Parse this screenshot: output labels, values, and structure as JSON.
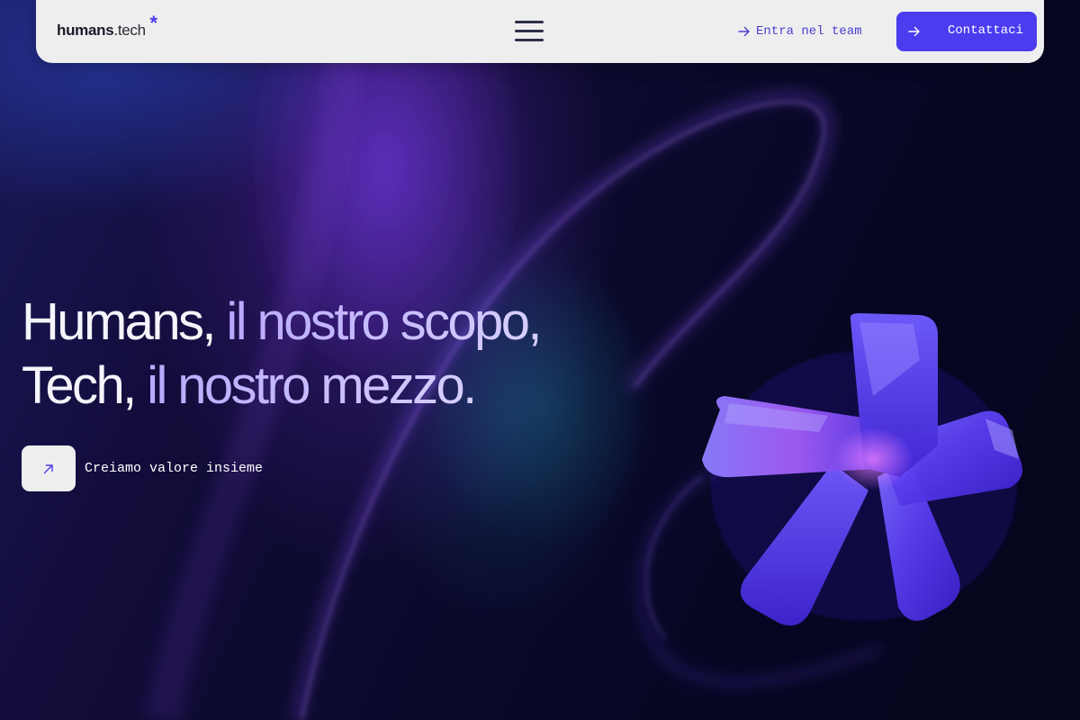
{
  "navbar": {
    "logo": {
      "bold": "humans",
      "dot": ".",
      "light": "tech",
      "mark": "*"
    },
    "menu_icon": "hamburger-menu-icon",
    "team_link": {
      "label": "Entra nel team",
      "icon": "arrow-right-icon"
    },
    "contact_button": {
      "label": "Contattaci",
      "icon": "arrow-right-icon"
    }
  },
  "hero": {
    "line1": {
      "white": "Humans,",
      "accent": " il nostro scopo,"
    },
    "line2": {
      "white": "Tech,",
      "accent": " il nostro mezzo."
    },
    "cta": {
      "icon": "arrow-up-right-icon",
      "label": "Creiamo valore insieme"
    },
    "visual": "3d-asterisk-graphic"
  },
  "colors": {
    "accent": "#4b3cf0",
    "navbar_bg": "#eeeeee",
    "page_bg": "#070720",
    "headline_accent": "#bfb2ff"
  }
}
